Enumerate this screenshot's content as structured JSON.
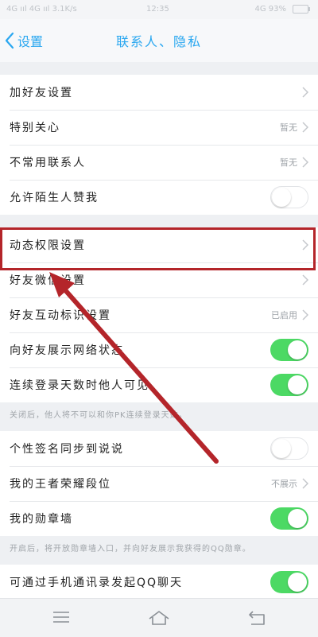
{
  "status_bar": {
    "left": "4G ııl 4G ııl 3.1K/s",
    "time": "12:35",
    "right": "4G 93%"
  },
  "nav": {
    "back_label": "设置",
    "title": "联系人、隐私"
  },
  "group1": {
    "rows": [
      {
        "label": "加好友设置",
        "type": "chevron"
      },
      {
        "label": "特别关心",
        "value": "暂无",
        "type": "chevron"
      },
      {
        "label": "不常用联系人",
        "value": "暂无",
        "type": "chevron"
      },
      {
        "label": "允许陌生人赞我",
        "type": "toggle",
        "on": false
      }
    ]
  },
  "group2": {
    "rows": [
      {
        "label": "动态权限设置",
        "type": "chevron"
      },
      {
        "label": "好友微信设置",
        "type": "chevron"
      },
      {
        "label": "好友互动标识设置",
        "value": "已启用",
        "type": "chevron"
      },
      {
        "label": "向好友展示网络状态",
        "type": "toggle",
        "on": true
      },
      {
        "label": "连续登录天数时他人可见",
        "type": "toggle",
        "on": true
      }
    ],
    "hint": "关闭后，他人将不可以和你PK连续登录天数。"
  },
  "group3": {
    "rows": [
      {
        "label": "个性签名同步到说说",
        "type": "toggle",
        "on": false
      },
      {
        "label": "我的王者荣耀段位",
        "value": "不展示",
        "type": "chevron"
      },
      {
        "label": "我的勋章墙",
        "type": "toggle",
        "on": true
      }
    ],
    "hint": "开启后，将开放勋章墙入口，并向好友展示我获得的QQ勋章。"
  },
  "group4": {
    "rows": [
      {
        "label": "可通过手机通讯录发起QQ聊天",
        "type": "toggle",
        "on": true
      }
    ]
  },
  "colors": {
    "accent": "#2aa7f0",
    "toggle_on": "#4cd964",
    "highlight": "#b4252a"
  },
  "icons": {
    "back": "chevron-left-icon",
    "row_chevron": "chevron-right-icon",
    "menu": "menu-icon",
    "home": "home-icon",
    "return": "return-icon"
  }
}
